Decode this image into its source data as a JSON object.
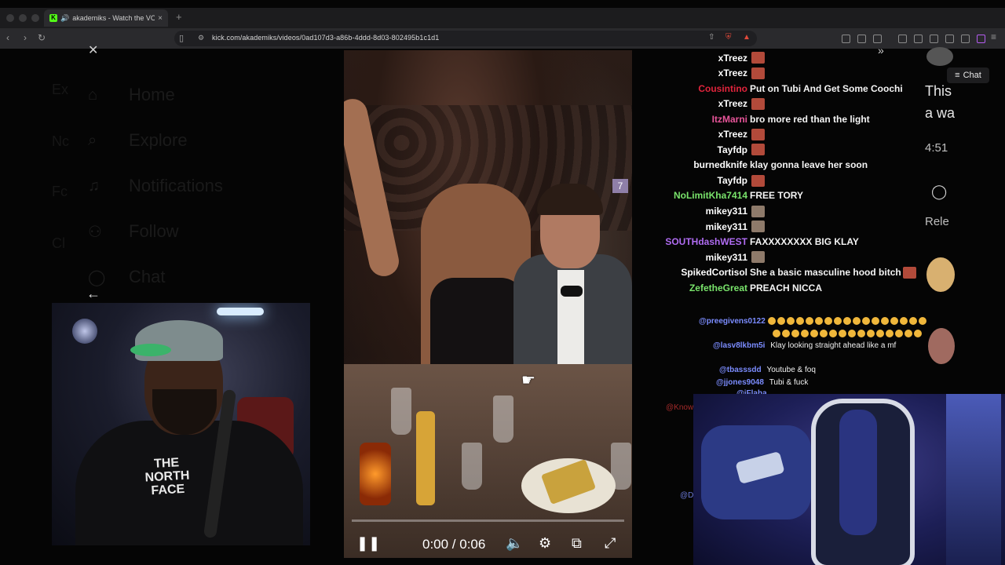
{
  "browser": {
    "tab_title": "akademiks - Watch the VOD",
    "tab_close": "×",
    "new_tab": "+",
    "url": "kick.com/akademiks/videos/0ad107d3-a86b-4ddd-8d03-802495b1c1d1"
  },
  "background_nav": {
    "items": [
      {
        "label": "Home",
        "icon": "home-icon"
      },
      {
        "label": "Explore",
        "icon": "search-icon"
      },
      {
        "label": "Notifications",
        "icon": "bell-icon"
      },
      {
        "label": "Follow",
        "icon": "add-user-icon"
      },
      {
        "label": "Chat",
        "icon": "chat-icon"
      }
    ]
  },
  "video": {
    "time": "0:00 / 0:06",
    "progress": 0.0,
    "badge": "7"
  },
  "chat": {
    "messages": [
      {
        "user": "xTreez",
        "color": "#ffffff",
        "msg": "",
        "emote": true
      },
      {
        "user": "xTreez",
        "color": "#ffffff",
        "msg": "",
        "emote": true
      },
      {
        "user": "Cousintino",
        "color": "#e0243c",
        "msg": "Put on Tubi And Get Some Coochi",
        "emote": false
      },
      {
        "user": "xTreez",
        "color": "#ffffff",
        "msg": "",
        "emote": true
      },
      {
        "user": "ItzMarni",
        "color": "#e8559a",
        "msg": "bro more red than the light",
        "emote": false
      },
      {
        "user": "xTreez",
        "color": "#ffffff",
        "msg": "",
        "emote": true
      },
      {
        "user": "Tayfdp",
        "color": "#ffffff",
        "msg": "",
        "emote": true
      },
      {
        "user": "burnedknife",
        "color": "#ffffff",
        "msg": "klay gonna leave her soon",
        "emote": false
      },
      {
        "user": "Tayfdp",
        "color": "#ffffff",
        "msg": "",
        "emote": true
      },
      {
        "user": "NoLimitKha7414",
        "color": "#79e36b",
        "msg": "FREE TORY",
        "emote": false
      },
      {
        "user": "mikey311",
        "color": "#ffffff",
        "msg": "",
        "emote": true
      },
      {
        "user": "mikey311",
        "color": "#ffffff",
        "msg": "",
        "emote": true
      },
      {
        "user": "SOUTHdashWEST",
        "color": "#b06cf2",
        "msg": "FAXXXXXXXX BIG KLAY",
        "emote": false
      },
      {
        "user": "mikey311",
        "color": "#ffffff",
        "msg": "",
        "emote": true
      },
      {
        "user": "SpikedCortisol",
        "color": "#ffffff",
        "msg": "She a basic masculine hood bitch",
        "emote": true
      },
      {
        "user": "ZefetheGreat",
        "color": "#79e36b",
        "msg": "PREACH NICCA",
        "emote": false
      }
    ]
  },
  "chat2": {
    "messages": [
      {
        "user": "@preegivens0122",
        "msg": ""
      },
      {
        "user": "@lasv8lkbm5i",
        "msg": "Klay looking straight ahead like a mf"
      },
      {
        "user": "@tbasssdd",
        "msg": "Youtube & foq"
      },
      {
        "user": "@jjones9048",
        "msg": "Tubi & fuck"
      },
      {
        "user": "@iFlaha",
        "msg": ""
      }
    ],
    "dim_red": "@Knowl",
    "dim_blue": "@Dr"
  },
  "side": {
    "chat_button": "Chat",
    "text1": "This",
    "text2": "a wa",
    "time": "4:51",
    "relevant": "Rele"
  }
}
